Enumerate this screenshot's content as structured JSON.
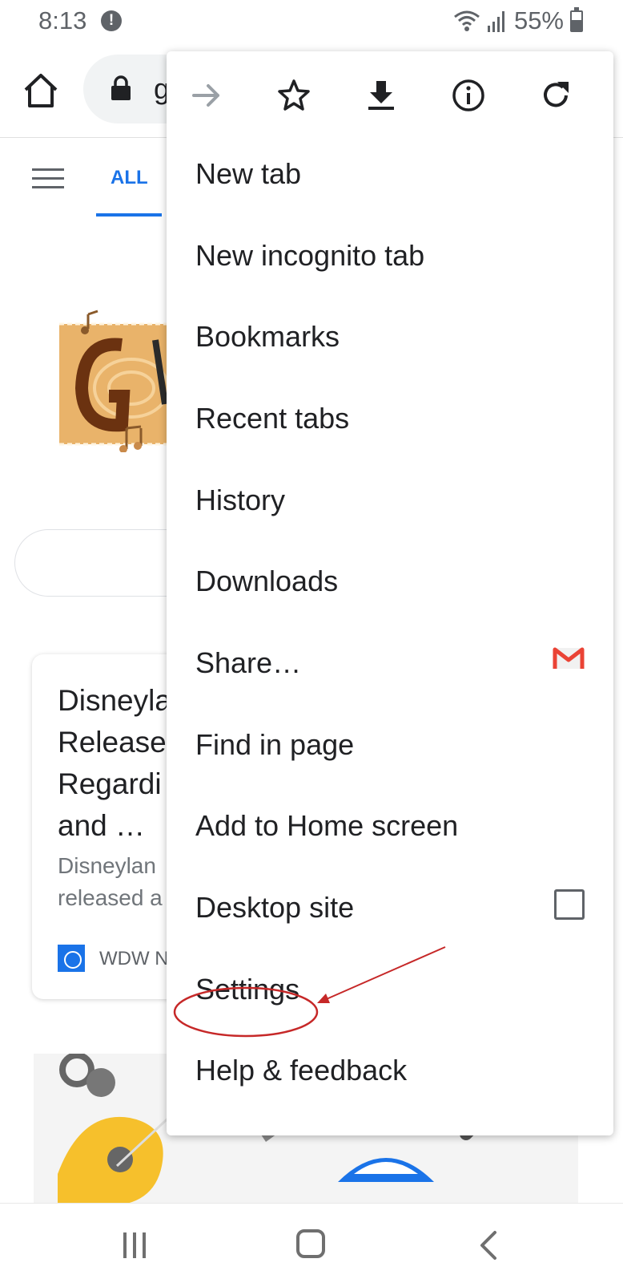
{
  "status_bar": {
    "time": "8:13",
    "alert_icon": "!",
    "battery_text": "55%",
    "icons": [
      "wifi-icon",
      "signal-icon",
      "battery-icon"
    ]
  },
  "toolbar": {
    "url_visible": "g"
  },
  "page": {
    "tab_all": "ALL",
    "news": {
      "title": "Disneyla\nRelease\nRegardi\nand …",
      "snippet": "Disneylan\nreleased a",
      "source": "WDW N"
    }
  },
  "menu": {
    "icon_row": [
      "forward-icon",
      "bookmark-star-icon",
      "download-icon",
      "page-info-icon",
      "reload-icon"
    ],
    "items": [
      {
        "label": "New tab"
      },
      {
        "label": "New incognito tab"
      },
      {
        "label": "Bookmarks"
      },
      {
        "label": "Recent tabs"
      },
      {
        "label": "History"
      },
      {
        "label": "Downloads"
      },
      {
        "label": "Share…",
        "right_icon": "gmail-icon"
      },
      {
        "label": "Find in page"
      },
      {
        "label": "Add to Home screen"
      },
      {
        "label": "Desktop site",
        "checkbox": false
      },
      {
        "label": "Settings",
        "annotated": true
      },
      {
        "label": "Help & feedback"
      }
    ]
  },
  "colors": {
    "accent": "#1a73e8",
    "annotation": "#c62828",
    "gmail_red": "#ea4335"
  }
}
